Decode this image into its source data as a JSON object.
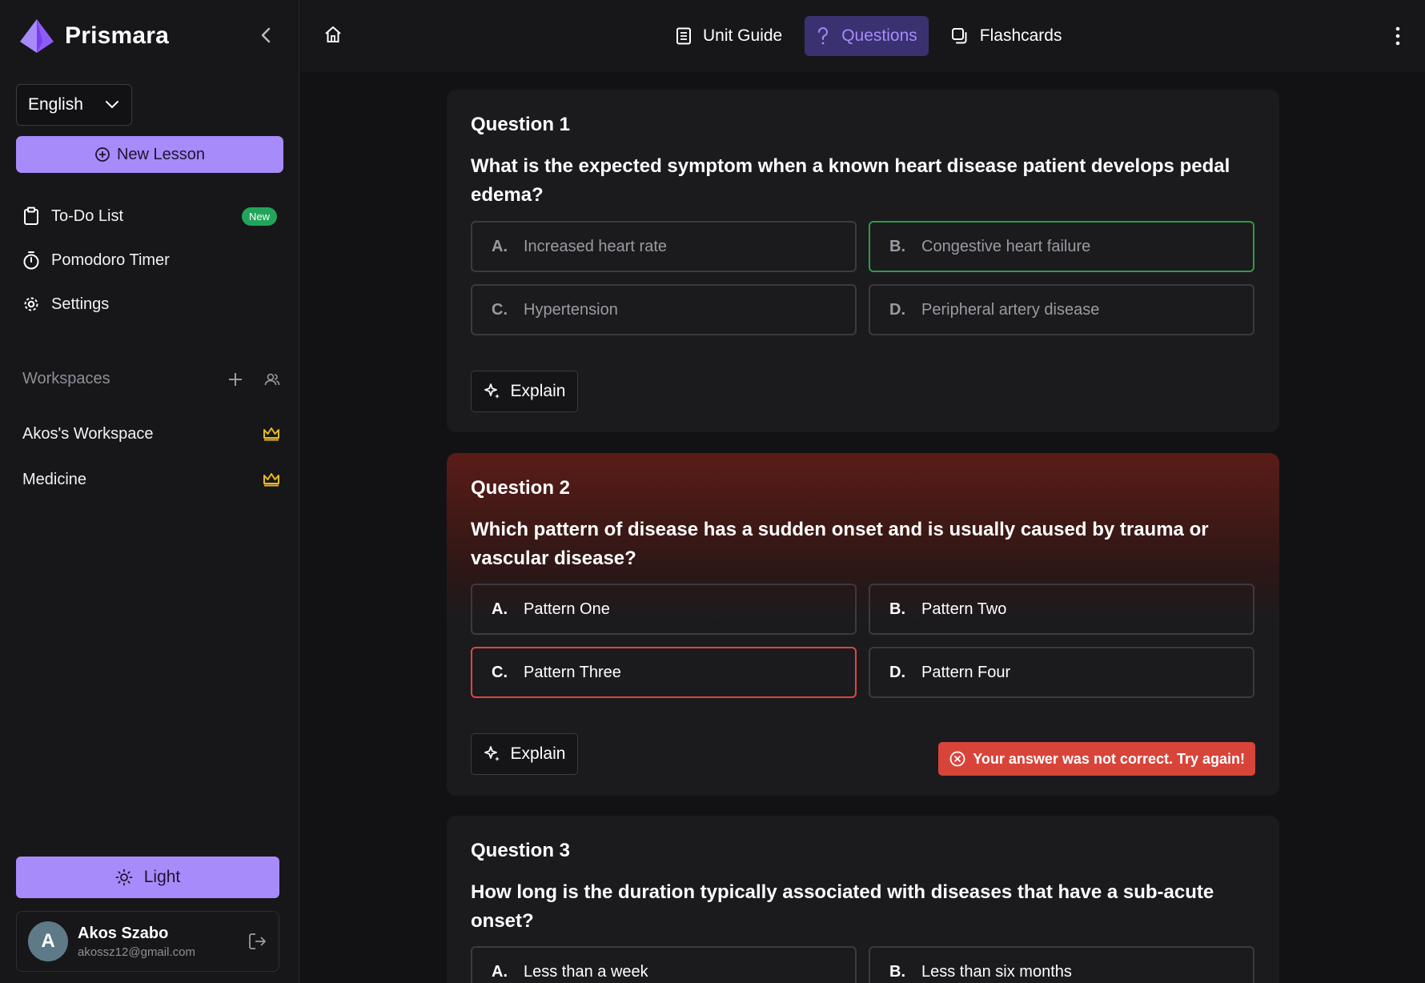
{
  "brand": {
    "name": "Prismara"
  },
  "language": {
    "selected": "English"
  },
  "new_lesson": {
    "label": "New Lesson"
  },
  "nav": {
    "todo": {
      "label": "To-Do List",
      "badge": "New"
    },
    "pomodoro": {
      "label": "Pomodoro Timer"
    },
    "settings": {
      "label": "Settings"
    }
  },
  "workspaces": {
    "header": "Workspaces",
    "items": [
      {
        "label": "Akos's Workspace"
      },
      {
        "label": "Medicine"
      }
    ]
  },
  "theme": {
    "label": "Light"
  },
  "user": {
    "initial": "A",
    "name": "Akos Szabo",
    "email": "akossz12@gmail.com"
  },
  "tabs": [
    {
      "label": "Unit Guide"
    },
    {
      "label": "Questions"
    },
    {
      "label": "Flashcards"
    }
  ],
  "questions": [
    {
      "number": "Question 1",
      "text": "What is the expected symptom when a known heart disease patient develops pedal edema?",
      "options": [
        {
          "letter": "A.",
          "text": "Increased heart rate"
        },
        {
          "letter": "B.",
          "text": "Congestive heart failure"
        },
        {
          "letter": "C.",
          "text": "Hypertension"
        },
        {
          "letter": "D.",
          "text": "Peripheral artery disease"
        }
      ],
      "explain": "Explain"
    },
    {
      "number": "Question 2",
      "text": "Which pattern of disease has a sudden onset and is usually caused by trauma or vascular disease?",
      "options": [
        {
          "letter": "A.",
          "text": "Pattern One"
        },
        {
          "letter": "B.",
          "text": "Pattern Two"
        },
        {
          "letter": "C.",
          "text": "Pattern Three"
        },
        {
          "letter": "D.",
          "text": "Pattern Four"
        }
      ],
      "explain": "Explain",
      "feedback": "Your answer was not correct. Try again!"
    },
    {
      "number": "Question 3",
      "text": "How long is the duration typically associated with diseases that have a sub-acute onset?",
      "options": [
        {
          "letter": "A.",
          "text": "Less than a week"
        },
        {
          "letter": "B.",
          "text": "Less than six months"
        }
      ]
    }
  ],
  "colors": {
    "accent": "#a78bfa",
    "correct": "#2e9a4a",
    "incorrect": "#e0463a",
    "badge_green": "#22a55b",
    "crown_gold": "#e8b923"
  }
}
